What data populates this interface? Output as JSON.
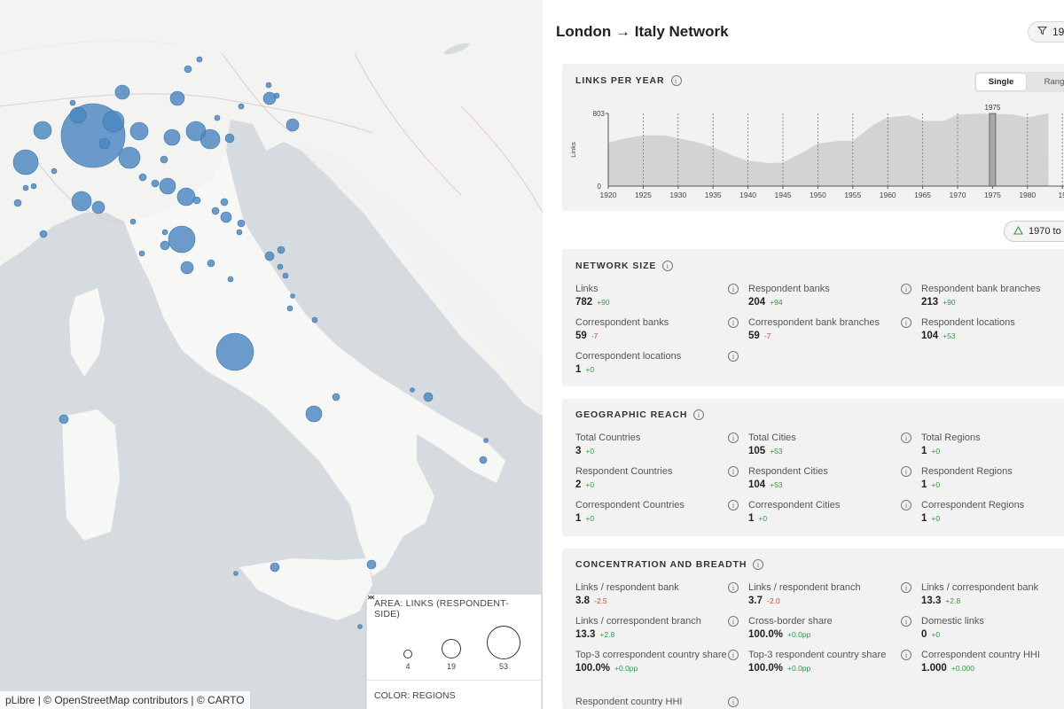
{
  "map": {
    "attribution": "pLibre | © OpenStreetMap contributors | © CARTO",
    "legend": {
      "area_label": "AREA: LINKS (RESPONDENT-SIDE)",
      "sizes": [
        "4",
        "19",
        "53"
      ],
      "color_label": "COLOR: REGIONS"
    },
    "marker_color": "#4b86c1"
  },
  "header": {
    "title": "London → Italy Network",
    "filter_label": "19"
  },
  "links_per_year": {
    "title": "LINKS PER YEAR",
    "toggle": [
      "Single",
      "Rang"
    ],
    "active_toggle": "Single",
    "y_label": "Links",
    "y_max": "803",
    "y_min": "0",
    "x_ticks": [
      "1920",
      "1925",
      "1930",
      "1935",
      "1940",
      "1945",
      "1950",
      "1955",
      "1960",
      "1965",
      "1970",
      "1975",
      "1980",
      "19"
    ],
    "selected_year": "1975",
    "range_label": "1970 to"
  },
  "chart_data": {
    "type": "area",
    "x": [
      1920,
      1922,
      1925,
      1928,
      1930,
      1933,
      1935,
      1938,
      1940,
      1943,
      1945,
      1948,
      1950,
      1953,
      1955,
      1958,
      1960,
      1963,
      1965,
      1968,
      1970,
      1973,
      1975,
      1978,
      1980,
      1983
    ],
    "y": [
      480,
      520,
      560,
      560,
      530,
      480,
      430,
      330,
      280,
      255,
      260,
      380,
      470,
      500,
      500,
      680,
      760,
      780,
      720,
      720,
      790,
      800,
      800,
      790,
      760,
      803
    ],
    "ylim": [
      0,
      803
    ],
    "xlabel": "",
    "ylabel": "Links"
  },
  "network_size": {
    "title": "NETWORK SIZE",
    "metrics": [
      {
        "label": "Links",
        "value": "782",
        "delta": "+90",
        "dir": "pos"
      },
      {
        "label": "Respondent banks",
        "value": "204",
        "delta": "+94",
        "dir": "pos"
      },
      {
        "label": "Respondent bank branches",
        "value": "213",
        "delta": "+90",
        "dir": "pos"
      },
      {
        "label": "Correspondent banks",
        "value": "59",
        "delta": "-7",
        "dir": "neg"
      },
      {
        "label": "Correspondent bank branches",
        "value": "59",
        "delta": "-7",
        "dir": "neg"
      },
      {
        "label": "Respondent locations",
        "value": "104",
        "delta": "+53",
        "dir": "pos"
      },
      {
        "label": "Correspondent locations",
        "value": "1",
        "delta": "+0",
        "dir": "pos"
      }
    ]
  },
  "geographic_reach": {
    "title": "GEOGRAPHIC REACH",
    "metrics": [
      {
        "label": "Total Countries",
        "value": "3",
        "delta": "+0",
        "dir": "pos"
      },
      {
        "label": "Total Cities",
        "value": "105",
        "delta": "+53",
        "dir": "pos"
      },
      {
        "label": "Total Regions",
        "value": "1",
        "delta": "+0",
        "dir": "pos"
      },
      {
        "label": "Respondent Countries",
        "value": "2",
        "delta": "+0",
        "dir": "pos"
      },
      {
        "label": "Respondent Cities",
        "value": "104",
        "delta": "+53",
        "dir": "pos"
      },
      {
        "label": "Respondent Regions",
        "value": "1",
        "delta": "+0",
        "dir": "pos"
      },
      {
        "label": "Correspondent Countries",
        "value": "1",
        "delta": "+0",
        "dir": "pos"
      },
      {
        "label": "Correspondent Cities",
        "value": "1",
        "delta": "+0",
        "dir": "pos"
      },
      {
        "label": "Correspondent Regions",
        "value": "1",
        "delta": "+0",
        "dir": "pos"
      }
    ]
  },
  "concentration": {
    "title": "CONCENTRATION AND BREADTH",
    "metrics": [
      {
        "label": "Links / respondent bank",
        "value": "3.8",
        "delta": "-2.5",
        "dir": "neg"
      },
      {
        "label": "Links / respondent branch",
        "value": "3.7",
        "delta": "-2.0",
        "dir": "neg"
      },
      {
        "label": "Links / correspondent bank",
        "value": "13.3",
        "delta": "+2.8",
        "dir": "pos"
      },
      {
        "label": "Links / correspondent branch",
        "value": "13.3",
        "delta": "+2.8",
        "dir": "pos"
      },
      {
        "label": "Cross-border share",
        "value": "100.0%",
        "delta": "+0.0pp",
        "dir": "pos"
      },
      {
        "label": "Domestic links",
        "value": "0",
        "delta": "+0",
        "dir": "pos"
      },
      {
        "label": "Top-3 correspondent country share",
        "value": "100.0%",
        "delta": "+0.0pp",
        "dir": "pos"
      },
      {
        "label": "Top-3 respondent country share",
        "value": "100.0%",
        "delta": "+0.0pp",
        "dir": "pos"
      },
      {
        "label": "Correspondent country HHI",
        "value": "1.000",
        "delta": "+0.000",
        "dir": "pos"
      },
      {
        "label": "Respondent country HHI",
        "value": "",
        "delta": "",
        "dir": "pos"
      }
    ]
  }
}
